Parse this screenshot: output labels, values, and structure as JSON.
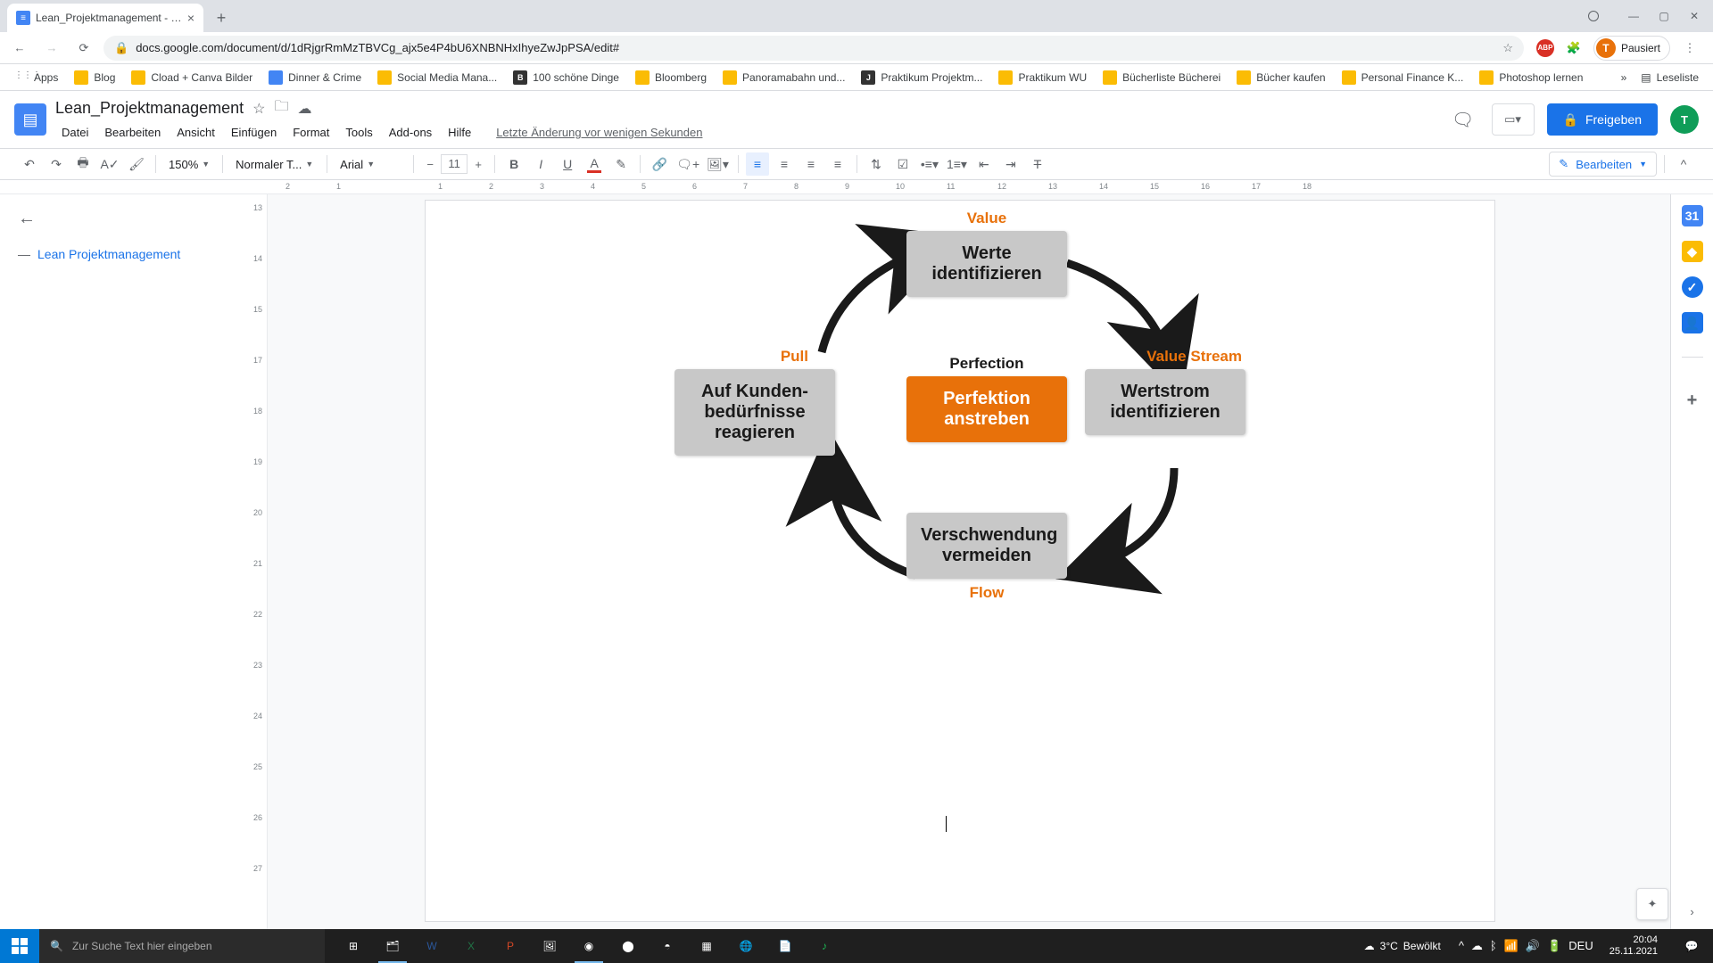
{
  "browser": {
    "tab_title": "Lean_Projektmanagement - Goo...",
    "url": "docs.google.com/document/d/1dRjgrRmMzTBVCg_ajx5e4P4bU6XNBNHxIhyeZwJpPSA/edit#",
    "profile_state": "Pausiert",
    "profile_initial": "T"
  },
  "bookmarks": [
    {
      "label": "Apps",
      "type": "apps"
    },
    {
      "label": "Blog",
      "type": "folder"
    },
    {
      "label": "Cload + Canva Bilder",
      "type": "folder"
    },
    {
      "label": "Dinner & Crime",
      "type": "blue"
    },
    {
      "label": "Social Media Mana...",
      "type": "folder"
    },
    {
      "label": "100 schöne Dinge",
      "type": "b"
    },
    {
      "label": "Bloomberg",
      "type": "folder"
    },
    {
      "label": "Panoramabahn und...",
      "type": "folder"
    },
    {
      "label": "Praktikum Projektm...",
      "type": "dark"
    },
    {
      "label": "Praktikum WU",
      "type": "folder"
    },
    {
      "label": "Bücherliste Bücherei",
      "type": "folder"
    },
    {
      "label": "Bücher kaufen",
      "type": "folder"
    },
    {
      "label": "Personal Finance K...",
      "type": "folder"
    },
    {
      "label": "Photoshop lernen",
      "type": "folder"
    }
  ],
  "bookmark_overflow": "Leseliste",
  "docs": {
    "title": "Lean_Projektmanagement",
    "menus": [
      "Datei",
      "Bearbeiten",
      "Ansicht",
      "Einfügen",
      "Format",
      "Tools",
      "Add-ons",
      "Hilfe"
    ],
    "last_edit": "Letzte Änderung vor wenigen Sekunden",
    "share": "Freigeben",
    "user_initial": "T"
  },
  "toolbar": {
    "zoom": "150%",
    "style": "Normaler T...",
    "font": "Arial",
    "font_size": "11",
    "edit_mode": "Bearbeiten"
  },
  "ruler_marks": [
    "2",
    "1",
    "",
    "1",
    "2",
    "3",
    "4",
    "5",
    "6",
    "7",
    "8",
    "9",
    "10",
    "11",
    "12",
    "13",
    "14",
    "15",
    "16",
    "17",
    "18"
  ],
  "left_ruler_marks": [
    "13",
    "14",
    "15",
    "17",
    "18",
    "19",
    "20",
    "21",
    "22",
    "23",
    "24",
    "25",
    "26",
    "27"
  ],
  "outline": {
    "item": "Lean Projektmanagement"
  },
  "cycle": {
    "top": {
      "label": "Value",
      "line1": "Werte",
      "line2": "identifizieren"
    },
    "right": {
      "label": "Value Stream",
      "line1": "Wertstrom",
      "line2": "identifizieren"
    },
    "bottom": {
      "label": "Flow",
      "line1": "Verschwendung",
      "line2": "vermeiden"
    },
    "left": {
      "label": "Pull",
      "line1": "Auf Kunden-",
      "line2": "bedürfnisse",
      "line3": "reagieren"
    },
    "center": {
      "label": "Perfection",
      "line1": "Perfektion",
      "line2": "anstreben"
    }
  },
  "taskbar": {
    "search_placeholder": "Zur Suche Text hier eingeben",
    "weather_temp": "3°C",
    "weather_desc": "Bewölkt",
    "lang": "DEU",
    "time": "20:04",
    "date": "25.11.2021"
  }
}
